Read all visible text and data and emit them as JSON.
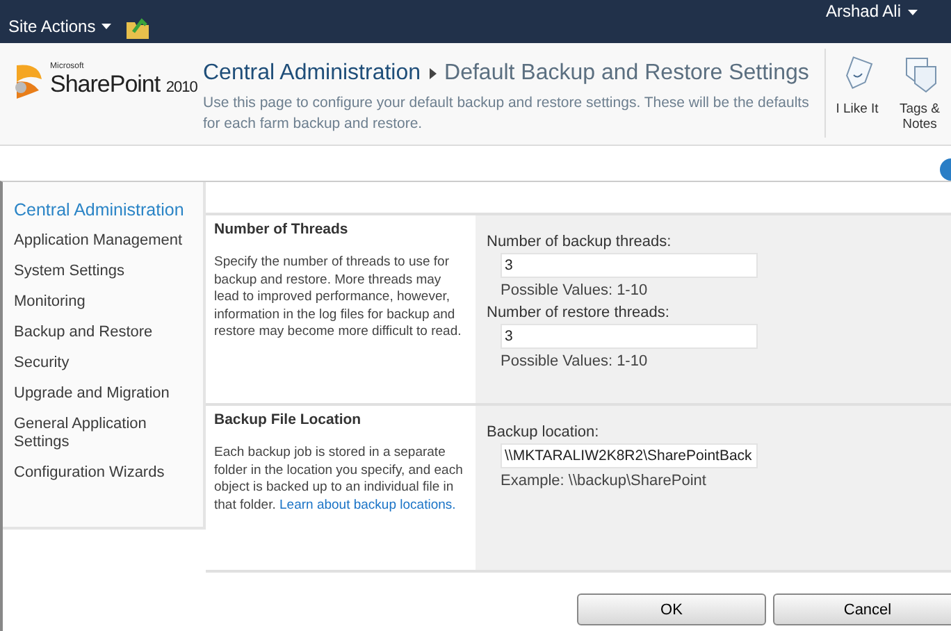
{
  "top_bar": {
    "site_actions": "Site Actions",
    "user": "Arshad Ali"
  },
  "header": {
    "logo": {
      "brand": "Microsoft",
      "product": "SharePoint",
      "version": "2010"
    },
    "breadcrumb": [
      {
        "label": "Central Administration"
      },
      {
        "label": "Default Backup and Restore Settings"
      }
    ],
    "description": "Use this page to configure your default backup and restore settings. These will be the defaults for each farm backup and restore.",
    "actions": [
      {
        "kind": "like",
        "label": "I Like It"
      },
      {
        "kind": "tags",
        "label": "Tags & Notes"
      }
    ]
  },
  "sidebar": {
    "items": [
      {
        "label": "Central Administration",
        "selected": true
      },
      {
        "label": "Application Management",
        "selected": false
      },
      {
        "label": "System Settings",
        "selected": false
      },
      {
        "label": "Monitoring",
        "selected": false
      },
      {
        "label": "Backup and Restore",
        "selected": false
      },
      {
        "label": "Security",
        "selected": false
      },
      {
        "label": "Upgrade and Migration",
        "selected": false
      },
      {
        "label": "General Application Settings",
        "selected": false
      },
      {
        "label": "Configuration Wizards",
        "selected": false
      }
    ]
  },
  "sections": [
    {
      "title": "Number of Threads",
      "description": "Specify the number of threads to use for backup and restore. More threads may lead to improved performance, however, information in the log files for backup and restore may become more difficult to read.",
      "fields": [
        {
          "label": "Number of backup threads:",
          "value": "3",
          "hint": "Possible Values: 1-10"
        },
        {
          "label": "Number of restore threads:",
          "value": "3",
          "hint": "Possible Values: 1-10"
        }
      ]
    },
    {
      "title": "Backup File Location",
      "description": "Each backup job is stored in a separate folder in the location you specify, and each object is backed up to an individual file in that folder.",
      "link": "Learn about backup locations.",
      "fields": [
        {
          "label": "Backup location:",
          "value": "\\\\MKTARALIW2K8R2\\SharePointBack",
          "hint": "Example: \\\\backup\\SharePoint"
        }
      ]
    }
  ],
  "buttons": [
    "OK",
    "Cancel"
  ]
}
